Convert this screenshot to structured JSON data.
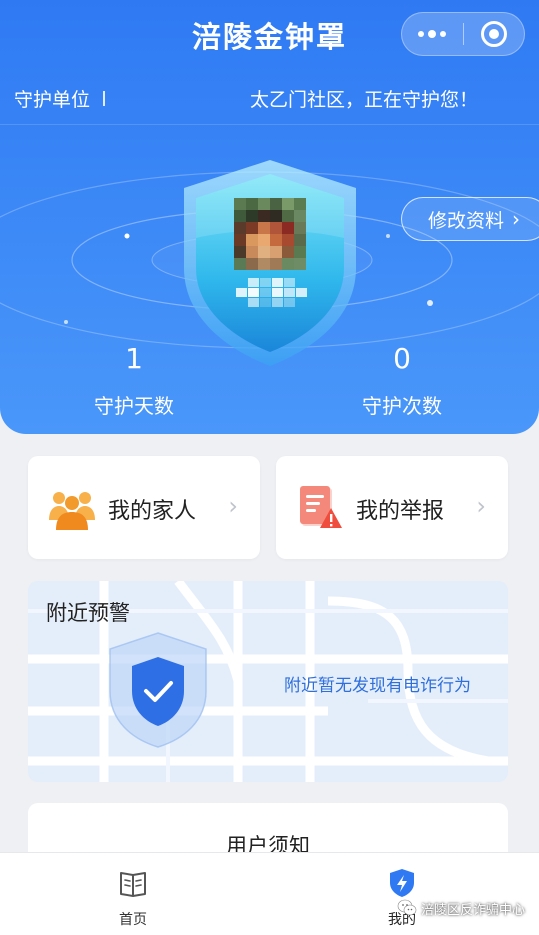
{
  "header": {
    "app_title": "涪陵金钟罩",
    "more_icon": "more-dots-icon",
    "close_icon": "target-ring-icon",
    "guard_label": "守护单位",
    "guard_message": "太乙门社区，正在守护您！",
    "edit_profile_label": "修改资料",
    "edit_profile_chevron": "›"
  },
  "stats": {
    "days_value": "1",
    "days_label": "守护天数",
    "times_value": "0",
    "times_label": "守护次数"
  },
  "cards": {
    "family_label": "我的家人",
    "report_label": "我的举报",
    "chevron": "›"
  },
  "nearby_warning": {
    "title": "附近预警",
    "message": "附近暂无发现有电诈行为"
  },
  "notice": {
    "title": "用户须知"
  },
  "tabbar": {
    "home_label": "首页",
    "mine_label": "我的"
  },
  "watermark": {
    "text": "涪陵区反诈骗中心"
  },
  "colors": {
    "header_blue": "#3d8af7",
    "accent_blue": "#2f6fdb",
    "family_orange": "#f3a13b",
    "report_red": "#f0695c"
  }
}
